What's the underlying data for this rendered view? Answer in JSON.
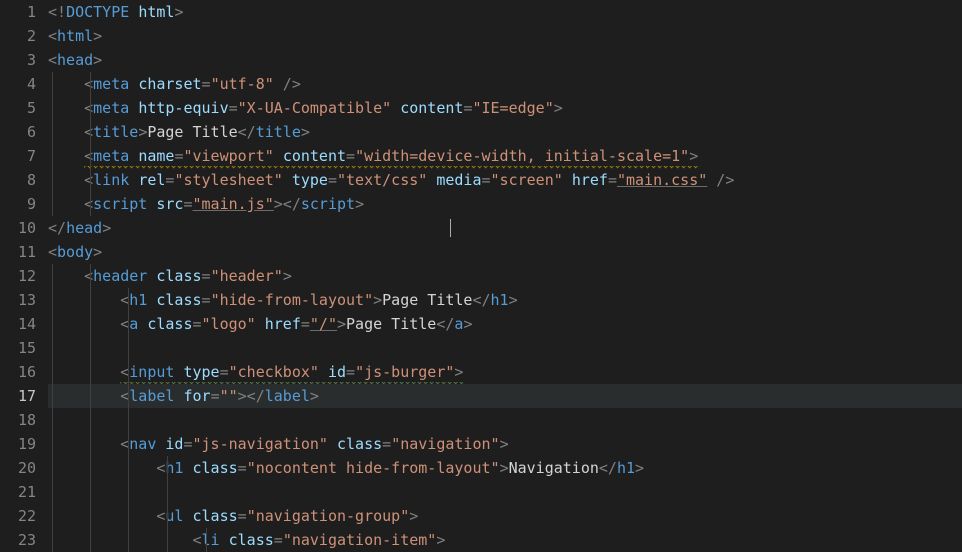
{
  "editor": {
    "active_line": 17,
    "cursor_line": 9,
    "lines": [
      {
        "n": 1,
        "indent": 0,
        "tokens": [
          [
            "punc",
            "<!"
          ],
          [
            "tag",
            "DOCTYPE"
          ],
          [
            "punc",
            " "
          ],
          [
            "attr",
            "html"
          ],
          [
            "punc",
            ">"
          ]
        ]
      },
      {
        "n": 2,
        "indent": 0,
        "tokens": [
          [
            "punc",
            "<"
          ],
          [
            "tag",
            "html"
          ],
          [
            "punc",
            ">"
          ]
        ]
      },
      {
        "n": 3,
        "indent": 0,
        "tokens": [
          [
            "punc",
            "<"
          ],
          [
            "tag",
            "head"
          ],
          [
            "punc",
            ">"
          ]
        ]
      },
      {
        "n": 4,
        "indent": 1,
        "tokens": [
          [
            "punc",
            "<"
          ],
          [
            "tag",
            "meta"
          ],
          [
            "punc",
            " "
          ],
          [
            "attr",
            "charset"
          ],
          [
            "punc",
            "="
          ],
          [
            "str",
            "\"utf-8\""
          ],
          [
            "punc",
            " />"
          ]
        ]
      },
      {
        "n": 5,
        "indent": 1,
        "tokens": [
          [
            "punc",
            "<"
          ],
          [
            "tag",
            "meta"
          ],
          [
            "punc",
            " "
          ],
          [
            "attr",
            "http-equiv"
          ],
          [
            "punc",
            "="
          ],
          [
            "str",
            "\"X-UA-Compatible\""
          ],
          [
            "punc",
            " "
          ],
          [
            "attr",
            "content"
          ],
          [
            "punc",
            "="
          ],
          [
            "str",
            "\"IE=edge\""
          ],
          [
            "punc",
            ">"
          ]
        ]
      },
      {
        "n": 6,
        "indent": 1,
        "tokens": [
          [
            "punc",
            "<"
          ],
          [
            "tag",
            "title"
          ],
          [
            "punc",
            ">"
          ],
          [
            "txt",
            "Page Title"
          ],
          [
            "punc",
            "</"
          ],
          [
            "tag",
            "title"
          ],
          [
            "punc",
            ">"
          ]
        ]
      },
      {
        "n": 7,
        "indent": 1,
        "squiggle": "y",
        "tokens": [
          [
            "punc",
            "<"
          ],
          [
            "tag",
            "meta"
          ],
          [
            "punc",
            " "
          ],
          [
            "attr",
            "name"
          ],
          [
            "punc",
            "="
          ],
          [
            "str",
            "\"viewport\""
          ],
          [
            "punc",
            " "
          ],
          [
            "attr",
            "content"
          ],
          [
            "punc",
            "="
          ],
          [
            "str",
            "\"width=device-width, initial-scale=1\""
          ],
          [
            "punc",
            ">"
          ]
        ]
      },
      {
        "n": 8,
        "indent": 1,
        "tokens": [
          [
            "punc",
            "<"
          ],
          [
            "tag",
            "link"
          ],
          [
            "punc",
            " "
          ],
          [
            "attr",
            "rel"
          ],
          [
            "punc",
            "="
          ],
          [
            "str",
            "\"stylesheet\""
          ],
          [
            "punc",
            " "
          ],
          [
            "attr",
            "type"
          ],
          [
            "punc",
            "="
          ],
          [
            "str",
            "\"text/css\""
          ],
          [
            "punc",
            " "
          ],
          [
            "attr",
            "media"
          ],
          [
            "punc",
            "="
          ],
          [
            "str",
            "\"screen\""
          ],
          [
            "punc",
            " "
          ],
          [
            "attr",
            "href"
          ],
          [
            "punc",
            "="
          ],
          [
            "str underline",
            "\"main.css\""
          ],
          [
            "punc",
            " />"
          ]
        ]
      },
      {
        "n": 9,
        "indent": 1,
        "tokens": [
          [
            "punc",
            "<"
          ],
          [
            "tag",
            "script"
          ],
          [
            "punc",
            " "
          ],
          [
            "attr",
            "src"
          ],
          [
            "punc",
            "="
          ],
          [
            "str underline",
            "\"main.js\""
          ],
          [
            "punc",
            "></"
          ],
          [
            "tag",
            "script"
          ],
          [
            "punc",
            ">"
          ]
        ]
      },
      {
        "n": 10,
        "indent": 0,
        "tokens": [
          [
            "punc",
            "</"
          ],
          [
            "tag",
            "head"
          ],
          [
            "punc",
            ">"
          ]
        ]
      },
      {
        "n": 11,
        "indent": 0,
        "tokens": [
          [
            "punc",
            "<"
          ],
          [
            "tag",
            "body"
          ],
          [
            "punc",
            ">"
          ]
        ]
      },
      {
        "n": 12,
        "indent": 1,
        "tokens": [
          [
            "punc",
            "<"
          ],
          [
            "tag",
            "header"
          ],
          [
            "punc",
            " "
          ],
          [
            "attr",
            "class"
          ],
          [
            "punc",
            "="
          ],
          [
            "str",
            "\"header\""
          ],
          [
            "punc",
            ">"
          ]
        ]
      },
      {
        "n": 13,
        "indent": 2,
        "tokens": [
          [
            "punc",
            "<"
          ],
          [
            "tag",
            "h1"
          ],
          [
            "punc",
            " "
          ],
          [
            "attr",
            "class"
          ],
          [
            "punc",
            "="
          ],
          [
            "str",
            "\"hide-from-layout\""
          ],
          [
            "punc",
            ">"
          ],
          [
            "txt",
            "Page Title"
          ],
          [
            "punc",
            "</"
          ],
          [
            "tag",
            "h1"
          ],
          [
            "punc",
            ">"
          ]
        ]
      },
      {
        "n": 14,
        "indent": 2,
        "tokens": [
          [
            "punc",
            "<"
          ],
          [
            "tag",
            "a"
          ],
          [
            "punc",
            " "
          ],
          [
            "attr",
            "class"
          ],
          [
            "punc",
            "="
          ],
          [
            "str",
            "\"logo\""
          ],
          [
            "punc",
            " "
          ],
          [
            "attr",
            "href"
          ],
          [
            "punc",
            "="
          ],
          [
            "str underline",
            "\"/\""
          ],
          [
            "punc",
            ">"
          ],
          [
            "txt",
            "Page Title"
          ],
          [
            "punc",
            "</"
          ],
          [
            "tag",
            "a"
          ],
          [
            "punc",
            ">"
          ]
        ]
      },
      {
        "n": 15,
        "indent": 2,
        "tokens": []
      },
      {
        "n": 16,
        "indent": 2,
        "squiggle": "g",
        "tokens": [
          [
            "punc",
            "<"
          ],
          [
            "tag",
            "input"
          ],
          [
            "punc",
            " "
          ],
          [
            "attr",
            "type"
          ],
          [
            "punc",
            "="
          ],
          [
            "str",
            "\"checkbox\""
          ],
          [
            "punc",
            " "
          ],
          [
            "attr",
            "id"
          ],
          [
            "punc",
            "="
          ],
          [
            "str",
            "\"js-burger\""
          ],
          [
            "punc",
            ">"
          ]
        ]
      },
      {
        "n": 17,
        "indent": 2,
        "tokens": [
          [
            "punc",
            "<"
          ],
          [
            "tag",
            "label"
          ],
          [
            "punc",
            " "
          ],
          [
            "attr",
            "for"
          ],
          [
            "punc",
            "="
          ],
          [
            "str",
            "\"\""
          ],
          [
            "punc",
            "></"
          ],
          [
            "tag",
            "label"
          ],
          [
            "punc",
            ">"
          ]
        ]
      },
      {
        "n": 18,
        "indent": 2,
        "tokens": []
      },
      {
        "n": 19,
        "indent": 2,
        "tokens": [
          [
            "punc",
            "<"
          ],
          [
            "tag",
            "nav"
          ],
          [
            "punc",
            " "
          ],
          [
            "attr",
            "id"
          ],
          [
            "punc",
            "="
          ],
          [
            "str",
            "\"js-navigation\""
          ],
          [
            "punc",
            " "
          ],
          [
            "attr",
            "class"
          ],
          [
            "punc",
            "="
          ],
          [
            "str",
            "\"navigation\""
          ],
          [
            "punc",
            ">"
          ]
        ]
      },
      {
        "n": 20,
        "indent": 3,
        "tokens": [
          [
            "punc",
            "<"
          ],
          [
            "tag",
            "h1"
          ],
          [
            "punc",
            " "
          ],
          [
            "attr",
            "class"
          ],
          [
            "punc",
            "="
          ],
          [
            "str",
            "\"nocontent hide-from-layout\""
          ],
          [
            "punc",
            ">"
          ],
          [
            "txt",
            "Navigation"
          ],
          [
            "punc",
            "</"
          ],
          [
            "tag",
            "h1"
          ],
          [
            "punc",
            ">"
          ]
        ]
      },
      {
        "n": 21,
        "indent": 3,
        "tokens": []
      },
      {
        "n": 22,
        "indent": 3,
        "tokens": [
          [
            "punc",
            "<"
          ],
          [
            "tag",
            "ul"
          ],
          [
            "punc",
            " "
          ],
          [
            "attr",
            "class"
          ],
          [
            "punc",
            "="
          ],
          [
            "str",
            "\"navigation-group\""
          ],
          [
            "punc",
            ">"
          ]
        ]
      },
      {
        "n": 23,
        "indent": 4,
        "tokens": [
          [
            "punc",
            "<"
          ],
          [
            "tag",
            "li"
          ],
          [
            "punc",
            " "
          ],
          [
            "attr",
            "class"
          ],
          [
            "punc",
            "="
          ],
          [
            "str",
            "\"navigation-item\""
          ],
          [
            "punc",
            ">"
          ]
        ]
      }
    ]
  }
}
